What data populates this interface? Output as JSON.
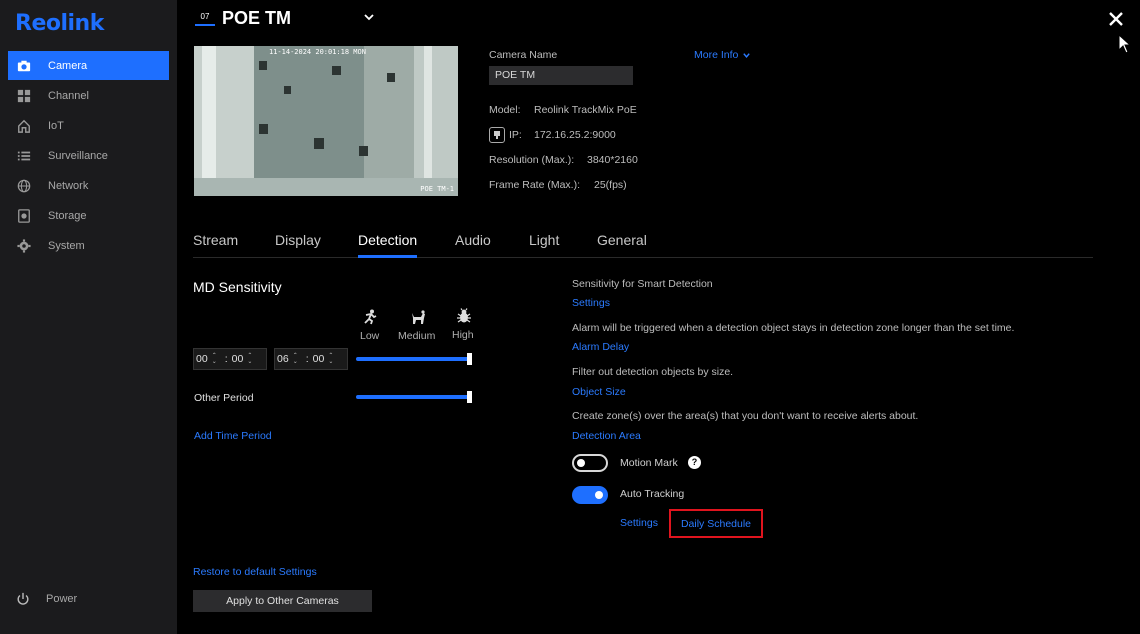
{
  "brand": "Reolink",
  "sidebar": {
    "items": [
      {
        "label": "Camera",
        "icon": "camera-icon",
        "active": true
      },
      {
        "label": "Channel",
        "icon": "grid-icon"
      },
      {
        "label": "IoT",
        "icon": "home-icon"
      },
      {
        "label": "Surveillance",
        "icon": "list-icon"
      },
      {
        "label": "Network",
        "icon": "globe-icon"
      },
      {
        "label": "Storage",
        "icon": "storage-icon"
      },
      {
        "label": "System",
        "icon": "gear-icon"
      }
    ],
    "power_label": "Power"
  },
  "header": {
    "channel_badge": "07",
    "camera_title": "POE TM"
  },
  "preview": {
    "timestamp": "11-14-2024 20:01:18 MON",
    "caption": "POE TM-1"
  },
  "info": {
    "camera_name_label": "Camera Name",
    "camera_name_value": "POE TM",
    "more_info_label": "More Info",
    "model_label": "Model:",
    "model_value": "Reolink TrackMix PoE",
    "ip_label": "IP:",
    "ip_value": "172.16.25.2:9000",
    "resolution_label": "Resolution (Max.):",
    "resolution_value": "3840*2160",
    "framerate_label": "Frame Rate (Max.):",
    "framerate_value": "25(fps)"
  },
  "tabs": [
    {
      "label": "Stream"
    },
    {
      "label": "Display"
    },
    {
      "label": "Detection",
      "active": true
    },
    {
      "label": "Audio"
    },
    {
      "label": "Light"
    },
    {
      "label": "General"
    }
  ],
  "md": {
    "title": "MD Sensitivity",
    "levels": [
      "Low",
      "Medium",
      "High"
    ],
    "period": {
      "start_h": "00",
      "start_m": "00",
      "end_h": "06",
      "end_m": "00",
      "sep": ":"
    },
    "period_sensitivity_percent": 100,
    "other_period_label": "Other Period",
    "other_period_sensitivity_percent": 100,
    "add_period_label": "Add Time Period"
  },
  "smart": {
    "sensitivity_desc": "Sensitivity for Smart Detection",
    "settings_link": "Settings",
    "alarm_desc": "Alarm will be triggered when a detection object stays in detection zone longer than the set time.",
    "alarm_delay_link": "Alarm Delay",
    "size_desc": "Filter out detection objects by size.",
    "object_size_link": "Object Size",
    "zone_desc": "Create zone(s) over the area(s) that you don't want to receive alerts about.",
    "detection_area_link": "Detection Area",
    "motion_mark_label": "Motion Mark",
    "motion_mark_on": false,
    "auto_tracking_label": "Auto Tracking",
    "auto_tracking_on": true,
    "tracking_settings_link": "Settings",
    "daily_schedule_link": "Daily Schedule"
  },
  "footer": {
    "restore_label": "Restore to default Settings",
    "apply_label": "Apply to Other Cameras"
  }
}
